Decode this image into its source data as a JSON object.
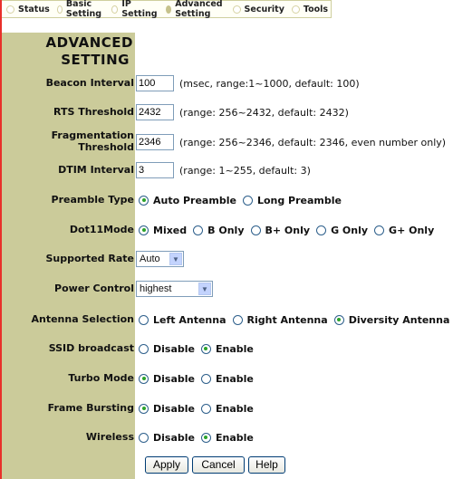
{
  "tabs": [
    {
      "label": "Status",
      "active": false
    },
    {
      "label": "Basic Setting",
      "active": false
    },
    {
      "label": "IP Setting",
      "active": false
    },
    {
      "label": "Advanced Setting",
      "active": true
    },
    {
      "label": "Security",
      "active": false
    },
    {
      "label": "Tools",
      "active": false
    }
  ],
  "page_title": {
    "line1": "ADVANCED",
    "line2": "SETTING"
  },
  "fields": {
    "beacon_interval": {
      "label": "Beacon Interval",
      "value": "100",
      "hint": "(msec, range:1~1000, default: 100)"
    },
    "rts_threshold": {
      "label": "RTS Threshold",
      "value": "2432",
      "hint": "(range: 256~2432, default: 2432)"
    },
    "fragmentation_threshold": {
      "label_line1": "Fragmentation",
      "label_line2": "Threshold",
      "value": "2346",
      "hint": "(range: 256~2346, default: 2346, even number only)"
    },
    "dtim_interval": {
      "label": "DTIM Interval",
      "value": "3",
      "hint": "(range: 1~255, default: 3)"
    }
  },
  "preamble": {
    "label": "Preamble Type",
    "options": [
      "Auto Preamble",
      "Long Preamble"
    ],
    "selected": "Auto Preamble"
  },
  "dot11mode": {
    "label": "Dot11Mode",
    "options": [
      "Mixed",
      "B Only",
      "B+ Only",
      "G Only",
      "G+ Only"
    ],
    "selected": "Mixed"
  },
  "supported_rate": {
    "label": "Supported Rate",
    "value": "Auto"
  },
  "power_control": {
    "label": "Power Control",
    "value": "highest"
  },
  "antenna": {
    "label": "Antenna Selection",
    "options": [
      "Left Antenna",
      "Right Antenna",
      "Diversity Antenna"
    ],
    "selected": "Diversity Antenna"
  },
  "ssid_broadcast": {
    "label": "SSID broadcast",
    "options": [
      "Disable",
      "Enable"
    ],
    "selected": "Enable"
  },
  "turbo_mode": {
    "label": "Turbo Mode",
    "options": [
      "Disable",
      "Enable"
    ],
    "selected": "Disable"
  },
  "frame_bursting": {
    "label": "Frame Bursting",
    "options": [
      "Disable",
      "Enable"
    ],
    "selected": "Disable"
  },
  "wireless": {
    "label": "Wireless",
    "options": [
      "Disable",
      "Enable"
    ],
    "selected": "Enable"
  },
  "buttons": {
    "apply": "Apply",
    "cancel": "Cancel",
    "help": "Help"
  },
  "colors": {
    "accent_left_column": "#cbcb9a",
    "red_edge": "#e8302a",
    "radio_selected": "#2ba32b"
  }
}
